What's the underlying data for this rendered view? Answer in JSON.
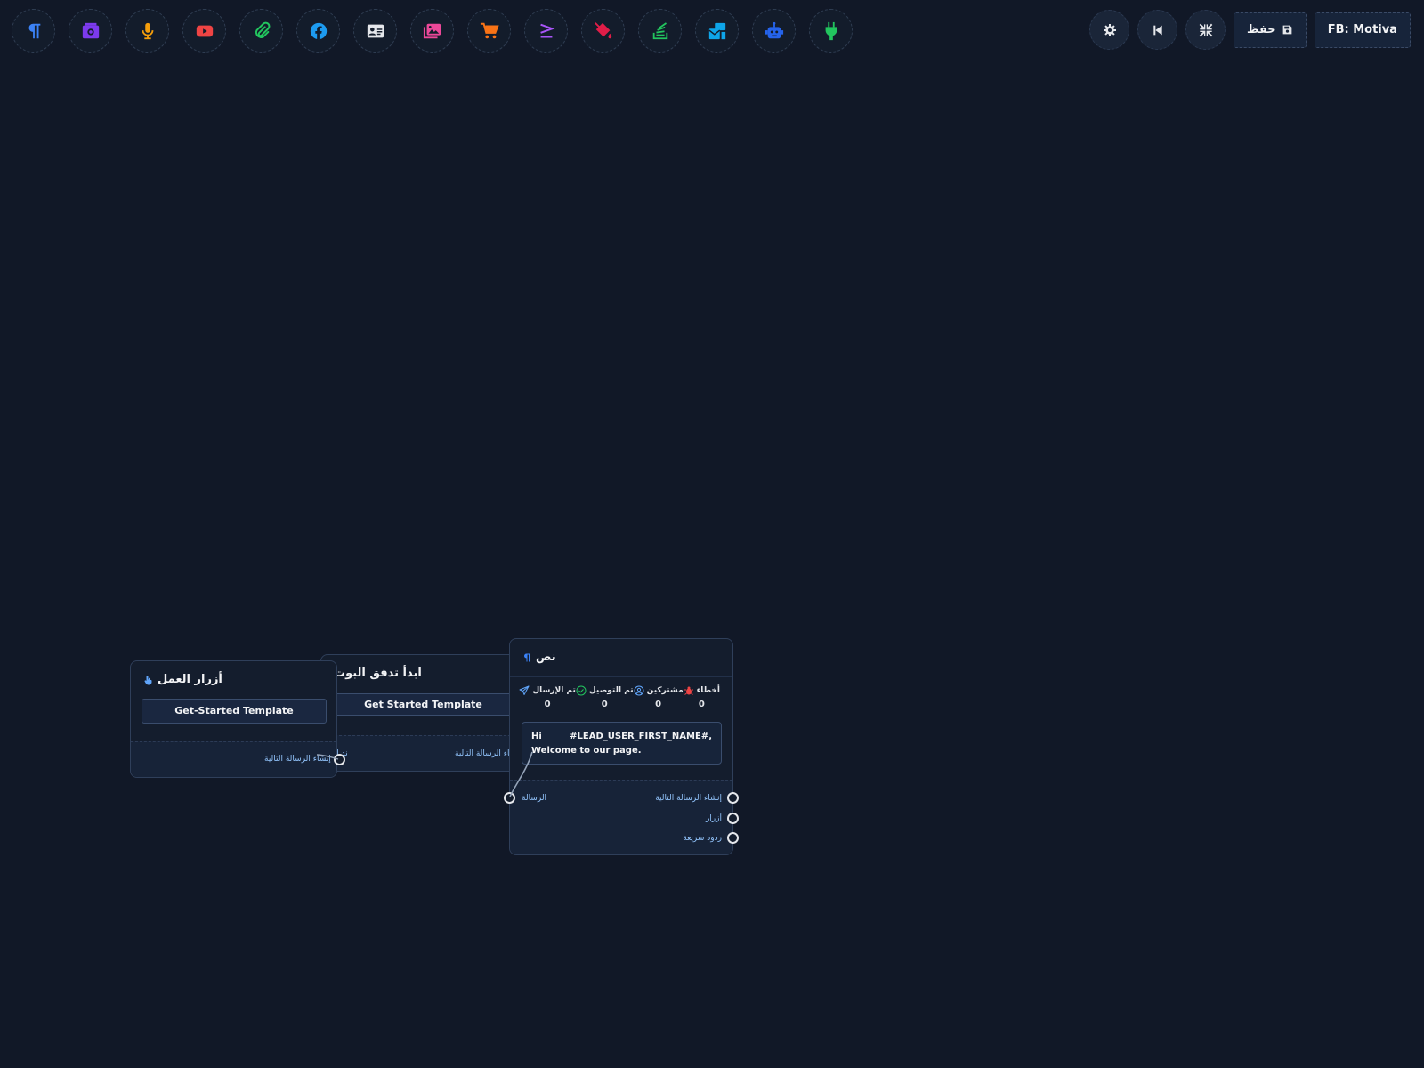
{
  "toolbar": {
    "tools": [
      {
        "name": "text-tool",
        "icon": "paragraph-icon",
        "color": "#3b82f6"
      },
      {
        "name": "image-tool",
        "icon": "camera-icon",
        "color": "#7c3aed"
      },
      {
        "name": "audio-tool",
        "icon": "microphone-icon",
        "color": "#f59e0b"
      },
      {
        "name": "video-tool",
        "icon": "youtube-icon",
        "color": "#ef4444"
      },
      {
        "name": "file-tool",
        "icon": "paperclip-icon",
        "color": "#22c55e"
      },
      {
        "name": "facebook-tool",
        "icon": "facebook-icon",
        "color": "#1d9bf0"
      },
      {
        "name": "card-tool",
        "icon": "contact-card-icon",
        "color": "#e5e7eb"
      },
      {
        "name": "gallery-tool",
        "icon": "gallery-icon",
        "color": "#ec4899"
      },
      {
        "name": "ecommerce-tool",
        "icon": "cart-icon",
        "color": "#f97316"
      },
      {
        "name": "condition-tool",
        "icon": "greater-equal-icon",
        "color": "#a855f7"
      },
      {
        "name": "action-tool",
        "icon": "paint-bucket-icon",
        "color": "#e11d48"
      },
      {
        "name": "stack-tool",
        "icon": "stack-icon",
        "color": "#22c55e"
      },
      {
        "name": "otn-tool",
        "icon": "mail-bulk-icon",
        "color": "#0ea5e9"
      },
      {
        "name": "ai-tool",
        "icon": "robot-icon",
        "color": "#2563eb"
      },
      {
        "name": "plugin-tool",
        "icon": "plug-icon",
        "color": "#22c55e"
      }
    ],
    "save_label": "حفظ",
    "page_label": "FB: Motiva"
  },
  "nodes": {
    "action_buttons": {
      "title": "أزرار العمل",
      "button": "Get-Started Template",
      "port_next": "إنشاء الرسالة التالية"
    },
    "start_flow": {
      "title": "ابدأ تدفق البوت",
      "button": "Get Started Template",
      "port_left": "ند الا",
      "port_next": "إنشاء الرسالة التالية"
    },
    "text": {
      "title": "نص",
      "stats": [
        {
          "label": "أخطاء",
          "value": "0",
          "icon": "bug-icon",
          "color": "#ef4444"
        },
        {
          "label": "مشتركين",
          "value": "0",
          "icon": "user-circle-icon",
          "color": "#60a5fa"
        },
        {
          "label": "تم التوصيل",
          "value": "0",
          "icon": "check-circle-icon",
          "color": "#22c55e"
        },
        {
          "label": "تم الإرسال",
          "value": "0",
          "icon": "send-icon",
          "color": "#60a5fa"
        }
      ],
      "message": "Hi #LEAD_USER_FIRST_NAME#, Welcome to our page.",
      "port_input": "الرسالة",
      "port_next": "إنشاء الرسالة التالية",
      "port_buttons": "أزرار",
      "port_quick_replies": "ردود سريعة"
    }
  }
}
